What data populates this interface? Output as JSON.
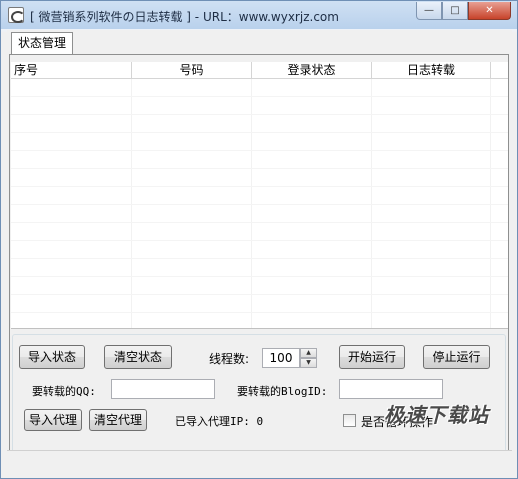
{
  "window": {
    "title": "[ 微营销系列软件の日志转载 ] - URL：www.wyxrjz.com",
    "minimize_glyph": "—",
    "maximize_glyph": "□",
    "close_glyph": "✕"
  },
  "tabs": [
    {
      "label": "状态管理"
    }
  ],
  "table": {
    "columns": [
      "序号",
      "号码",
      "登录状态",
      "日志转载"
    ],
    "rows": []
  },
  "controls": {
    "import_status_label": "导入状态",
    "clear_status_label": "清空状态",
    "thread_count_label": "线程数:",
    "thread_count_value": "100",
    "start_label": "开始运行",
    "stop_label": "停止运行",
    "qq_label": "要转载的QQ:",
    "qq_value": "",
    "blogid_label": "要转载的BlogID:",
    "blogid_value": "",
    "import_proxy_label": "导入代理",
    "clear_proxy_label": "清空代理",
    "imported_proxy_label": "已导入代理IP: 0",
    "loop_label": "是否循环操作",
    "loop_checked": false
  },
  "watermark": "极速下载站"
}
